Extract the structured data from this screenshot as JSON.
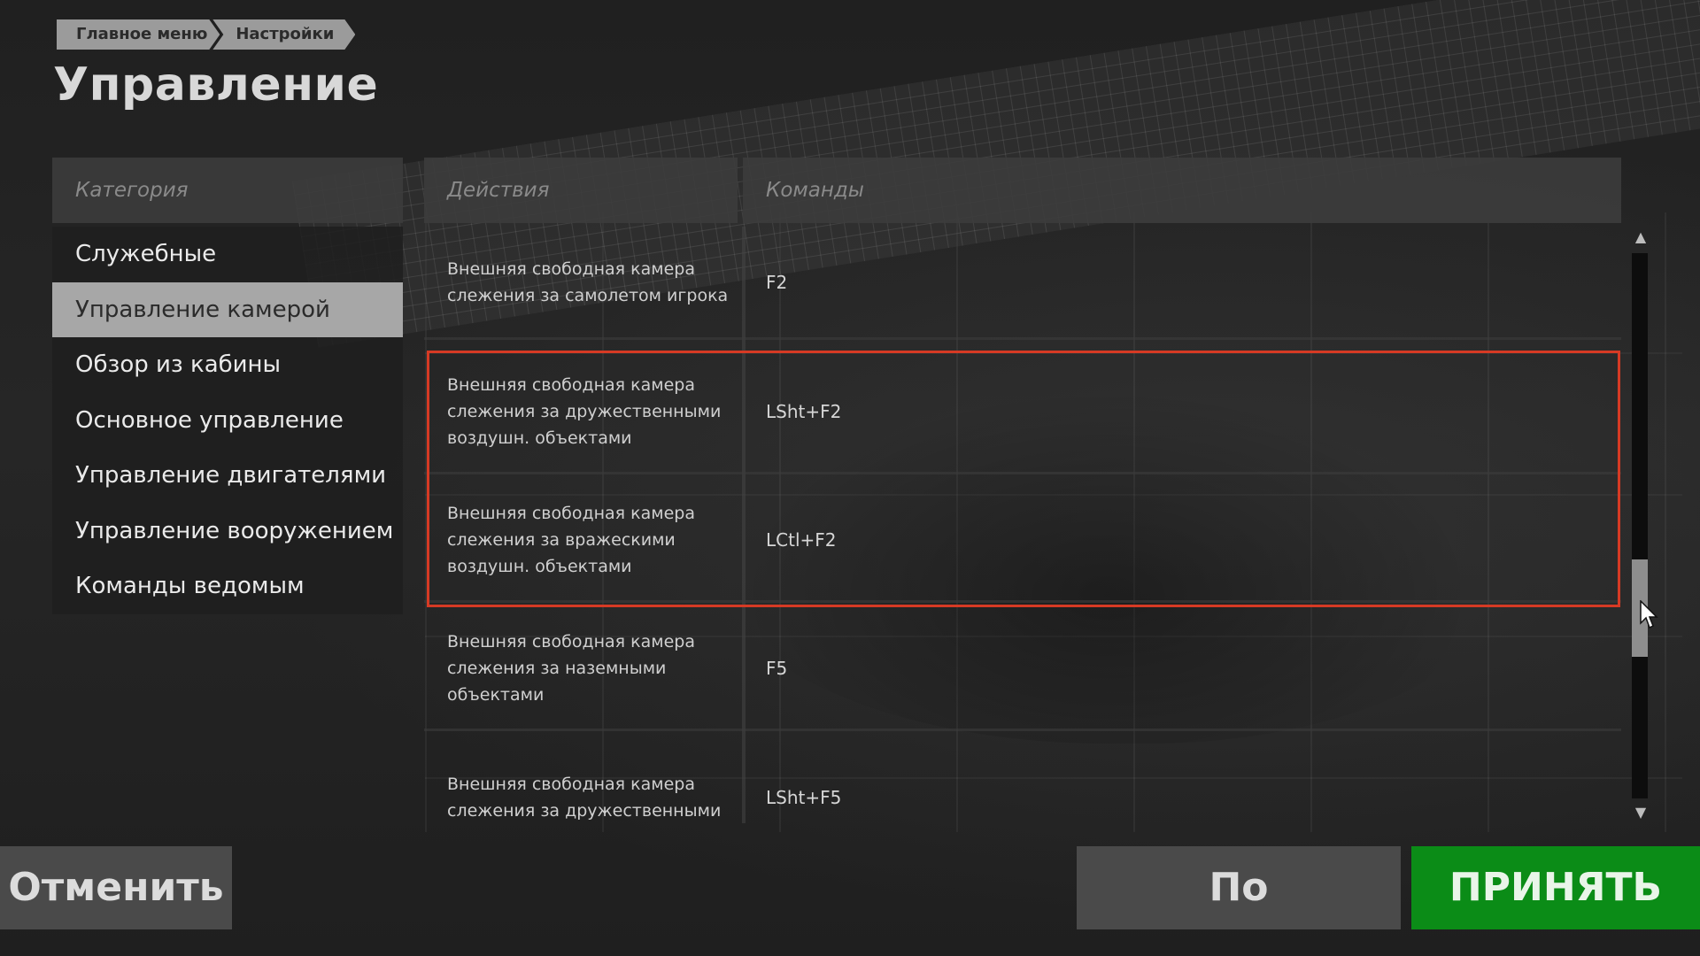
{
  "breadcrumb": {
    "items": [
      "Главное меню",
      "Настройки"
    ]
  },
  "page_title": "Управление",
  "headers": {
    "category": "Категория",
    "actions": "Действия",
    "commands": "Команды"
  },
  "categories": [
    {
      "label": "Служебные",
      "active": false
    },
    {
      "label": "Управление камерой",
      "active": true
    },
    {
      "label": "Обзор из кабины",
      "active": false
    },
    {
      "label": "Основное управление",
      "active": false
    },
    {
      "label": "Управление двигателями",
      "active": false
    },
    {
      "label": "Управление вооружением",
      "active": false
    },
    {
      "label": "Команды ведомым",
      "active": false
    }
  ],
  "actions": [
    {
      "action": "Внешняя свободная камера слежения за самолетом игрока",
      "command": "F2"
    },
    {
      "action": "Внешняя свободная камера слежения за дружественными воздушн. объектами",
      "command": "LSht+F2"
    },
    {
      "action": "Внешняя свободная камера слежения за вражескими воздушн. объектами",
      "command": "LCtl+F2"
    },
    {
      "action": "Внешняя свободная камера слежения за наземными объектами",
      "command": "F5"
    },
    {
      "action": "Внешняя свободная камера слежения за дружественными",
      "command": "LSht+F5"
    }
  ],
  "scrollbar": {
    "up_icon": "▲",
    "down_icon": "▼"
  },
  "buttons": {
    "cancel": "Отменить",
    "default": "По умолчанию",
    "accept": "ПРИНЯТЬ"
  },
  "colors": {
    "accept": "#0b8c17",
    "selection": "#d63a24",
    "active_category": "#a7a7a7"
  }
}
